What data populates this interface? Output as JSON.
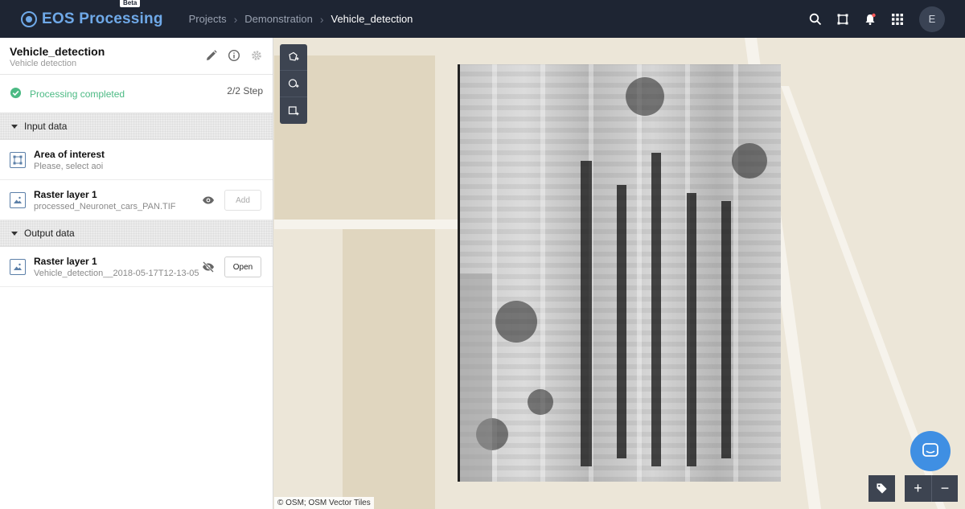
{
  "app": {
    "name": "EOS Processing",
    "badge": "Beta"
  },
  "breadcrumbs": [
    "Projects",
    "Demonstration",
    "Vehicle_detection"
  ],
  "user": {
    "initial": "E"
  },
  "panel": {
    "title": "Vehicle_detection",
    "subtitle": "Vehicle detection",
    "status_text": "Processing completed",
    "step": "2/2 Step",
    "input_section": "Input data",
    "output_section": "Output data",
    "inputs": [
      {
        "title": "Area of interest",
        "subtitle": "Please, select aoi"
      },
      {
        "title": "Raster layer 1",
        "subtitle": "processed_Neuronet_cars_PAN.TIF",
        "button": "Add"
      }
    ],
    "outputs": [
      {
        "title": "Raster layer 1",
        "subtitle": "Vehicle_detection__2018-05-17T12-13-05",
        "button": "Open"
      }
    ]
  },
  "map": {
    "attribution": "© OSM; OSM Vector Tiles",
    "zoom_in": "+",
    "zoom_out": "−"
  },
  "colors": {
    "topbar": "#1e2533",
    "accent": "#6fa9e8",
    "success": "#4cba84",
    "chat": "#3f8fe3"
  },
  "icons": [
    "search-icon",
    "polygon-icon",
    "bell-icon",
    "apps-grid-icon",
    "pencil-icon",
    "info-icon",
    "gear-icon",
    "check-circle-icon",
    "aoi-icon",
    "image-icon",
    "eye-icon",
    "eye-off-icon",
    "draw-polygon-icon",
    "draw-circle-icon",
    "draw-rectangle-icon",
    "tag-icon",
    "chat-icon"
  ]
}
